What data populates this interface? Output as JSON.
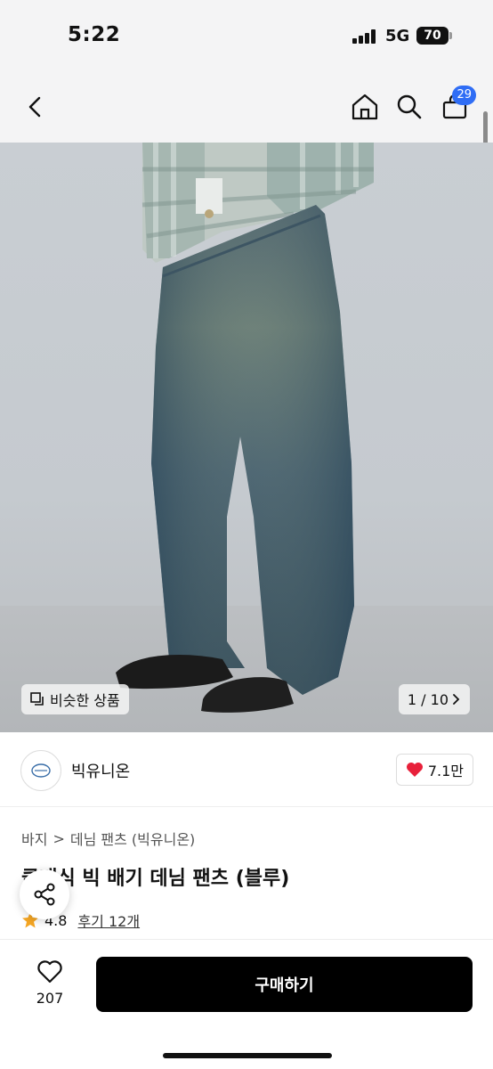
{
  "status_bar": {
    "time": "5:22",
    "network": "5G",
    "battery": "70"
  },
  "header": {
    "cart_count": "29"
  },
  "product_image": {
    "similar_label": "비슷한 상품",
    "page_counter": "1 / 10"
  },
  "brand": {
    "name": "빅유니온",
    "likes": "7.1만"
  },
  "breadcrumb": {
    "category": "바지",
    "separator": ">",
    "subcategory": "데님 팬츠 (빅유니온)"
  },
  "product": {
    "title": "클래식 빅 배기 데님 팬츠 (블루)",
    "rating": "4.8",
    "reviews": "후기 12개"
  },
  "bottom_bar": {
    "wish_count": "207",
    "buy_label": "구매하기"
  },
  "colors": {
    "accent_blue": "#2f6df5",
    "heart_red": "#e8203a",
    "star_orange": "#f5a623",
    "buy_bg": "#000000"
  }
}
